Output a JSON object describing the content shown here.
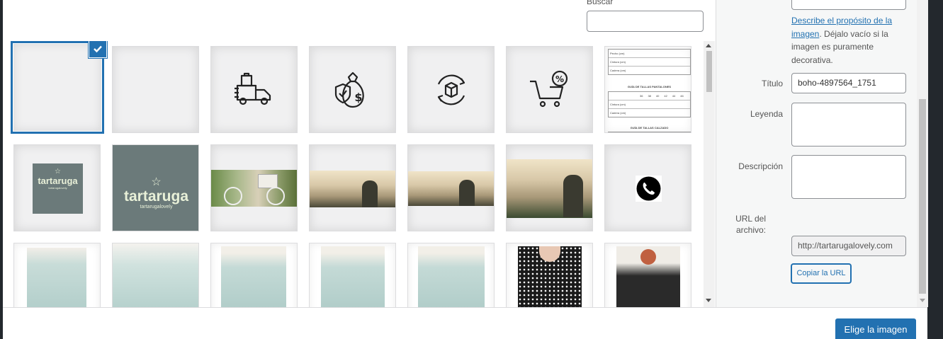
{
  "search": {
    "label": "Buscar",
    "value": ""
  },
  "sidebar": {
    "alt_help_link": "Describe el propósito de la imagen",
    "alt_help_rest": ". Déjalo vacío si la imagen es puramente decorativa.",
    "title_label": "Título",
    "title_value": "boho-4897564_1751",
    "caption_label": "Leyenda",
    "description_label": "Descripción",
    "url_label": "URL del archivo:",
    "url_value": "http://tartarugalovely.com",
    "copy_button": "Copiar la URL"
  },
  "logo_text": {
    "name": "tartaruga",
    "sub": "tartarugalovely"
  },
  "size_table": {
    "pants_heading": "GUÍA DE TALLAS PANTALONES",
    "shoes_heading": "GUÍA DE TALLAS CALZADO",
    "rows_top": [
      "Pecho (cm)",
      "Cintura (cm)",
      "Cadera (cm)"
    ],
    "rows_mid": [
      "Cintura (cm)",
      "Cadera (cm)"
    ],
    "sizes": [
      "36",
      "38",
      "40",
      "42",
      "44",
      "46"
    ]
  },
  "footer": {
    "choose_button": "Elige la imagen"
  },
  "colors": {
    "accent": "#2271b1",
    "logo_bg": "#6b7a7a",
    "logo_text": "#e8f0d8",
    "phone": "#000000"
  }
}
